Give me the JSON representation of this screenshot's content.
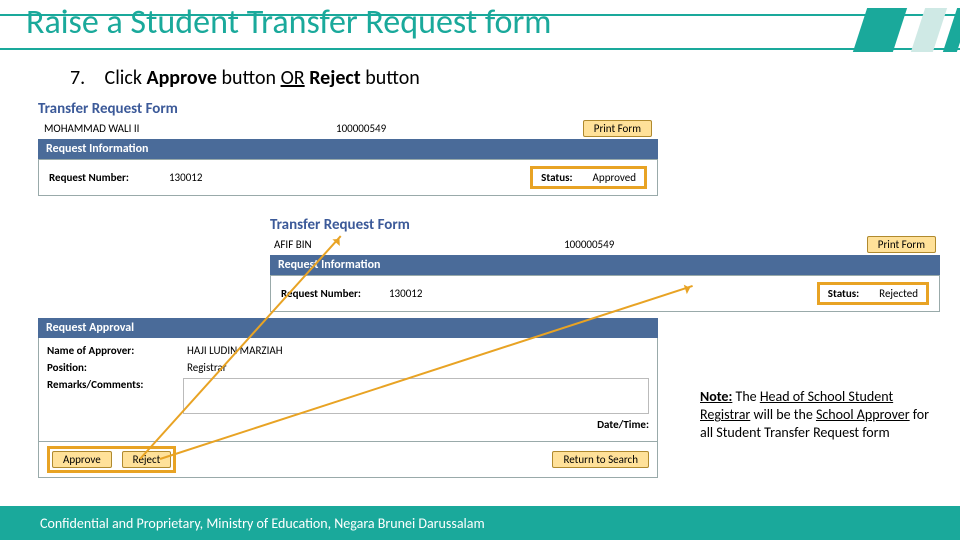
{
  "slide": {
    "title": "Raise a Student Transfer Request form",
    "step_number": "7.",
    "step_prefix": "Click ",
    "step_bold1": "Approve",
    "step_mid1": " button ",
    "step_or": "OR",
    "step_bold2": " Reject",
    "step_tail": " button",
    "footer": "Confidential and Proprietary, Ministry of Education, Negara Brunei Darussalam"
  },
  "form1": {
    "heading": "Transfer Request Form",
    "student_name": "MOHAMMAD WALI II",
    "student_id": "100000549",
    "print": "Print Form",
    "section": "Request Information",
    "req_label": "Request Number:",
    "req_value": "130012",
    "status_label": "Status:",
    "status_value": "Approved"
  },
  "form2": {
    "heading": "Transfer Request Form",
    "student_name": "AFIF BIN",
    "student_id": "100000549",
    "print": "Print Form",
    "section": "Request Information",
    "req_label": "Request Number:",
    "req_value": "130012",
    "status_label": "Status:",
    "status_value": "Rejected"
  },
  "approval": {
    "section": "Request Approval",
    "name_label": "Name of Approver:",
    "name_value": "HAJI LUDIN MARZIAH",
    "position_label": "Position:",
    "position_value": "Registrar",
    "remarks_label": "Remarks/Comments:",
    "datetime_label": "Date/Time:",
    "approve_btn": "Approve",
    "reject_btn": "Reject",
    "return_btn": "Return to Search"
  },
  "note": {
    "lead": "Note:",
    "t1": " The ",
    "role": "Head of School Student Registrar",
    "t2": " will be the ",
    "approver": "School Approver",
    "t3": " for all Student Transfer Request form"
  }
}
